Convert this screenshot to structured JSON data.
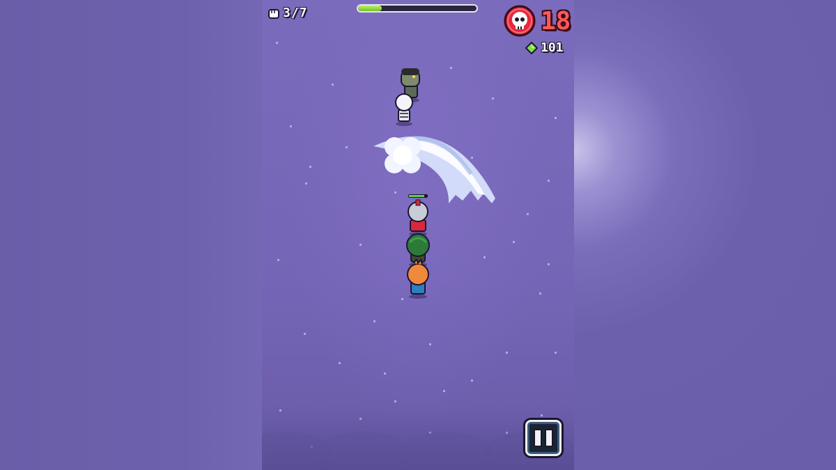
{
  "hud": {
    "squad_count": "3/7",
    "wave_progress": 0.2,
    "kill_count": "18",
    "gem_count": "101",
    "icons": {
      "squad": "fist-icon",
      "kills": "skull-icon",
      "gems": "green-gem-icon",
      "pause": "pause-icon"
    }
  },
  "colors": {
    "ground": "#7565b6",
    "kill_text": "#ff5858",
    "progress_fill": "#8bd23a",
    "gem": "#7fe04a"
  },
  "characters": {
    "enemies": [
      "zombie",
      "skeleton"
    ],
    "squad": [
      "knight",
      "green-hood",
      "orange-hair"
    ]
  }
}
